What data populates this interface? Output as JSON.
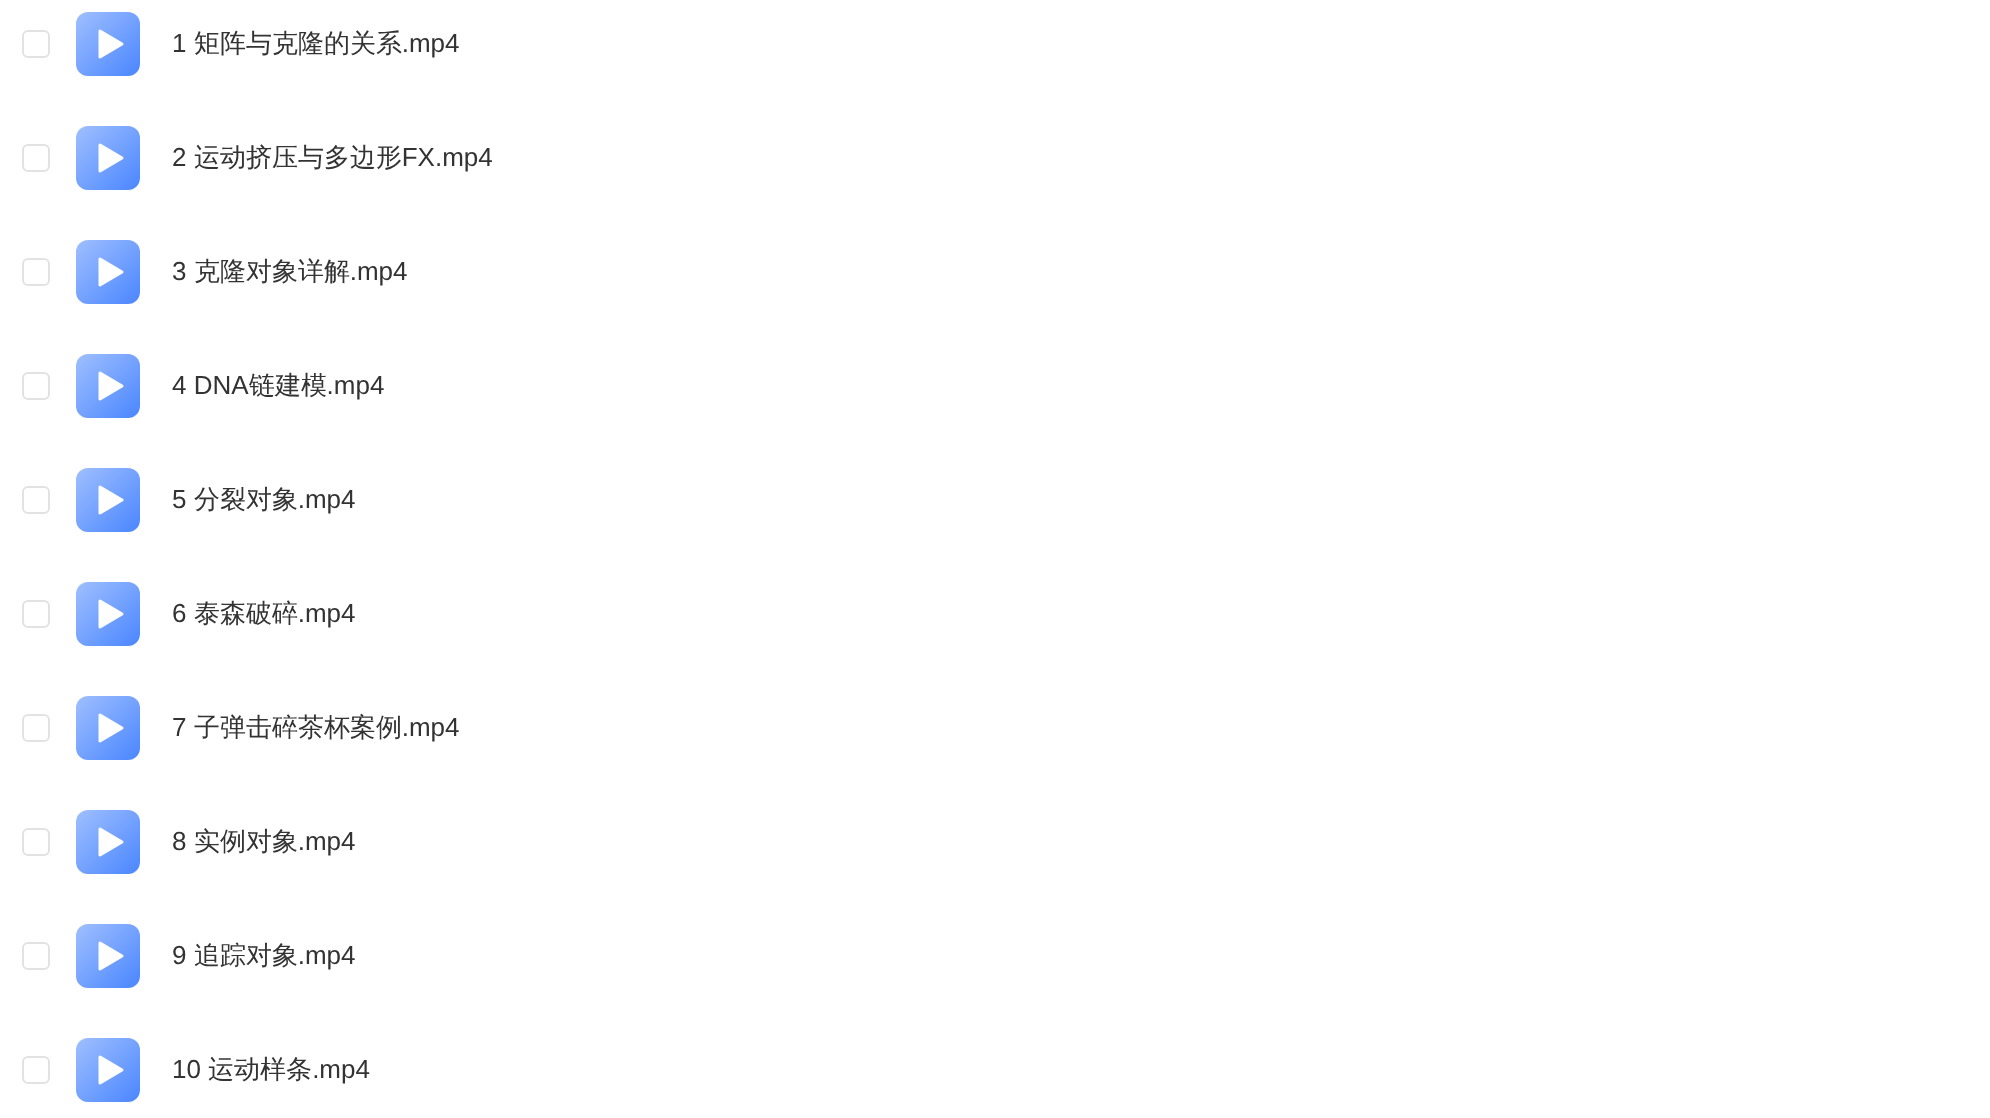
{
  "files": [
    {
      "name": "1 矩阵与克隆的关系.mp4",
      "checked": false
    },
    {
      "name": "2 运动挤压与多边形FX.mp4",
      "checked": false
    },
    {
      "name": "3 克隆对象详解.mp4",
      "checked": false
    },
    {
      "name": "4 DNA链建模.mp4",
      "checked": false
    },
    {
      "name": "5 分裂对象.mp4",
      "checked": false
    },
    {
      "name": "6 泰森破碎.mp4",
      "checked": false
    },
    {
      "name": "7 子弹击碎茶杯案例.mp4",
      "checked": false
    },
    {
      "name": "8 实例对象.mp4",
      "checked": false
    },
    {
      "name": "9 追踪对象.mp4",
      "checked": false
    },
    {
      "name": "10 运动样条.mp4",
      "checked": false
    }
  ]
}
